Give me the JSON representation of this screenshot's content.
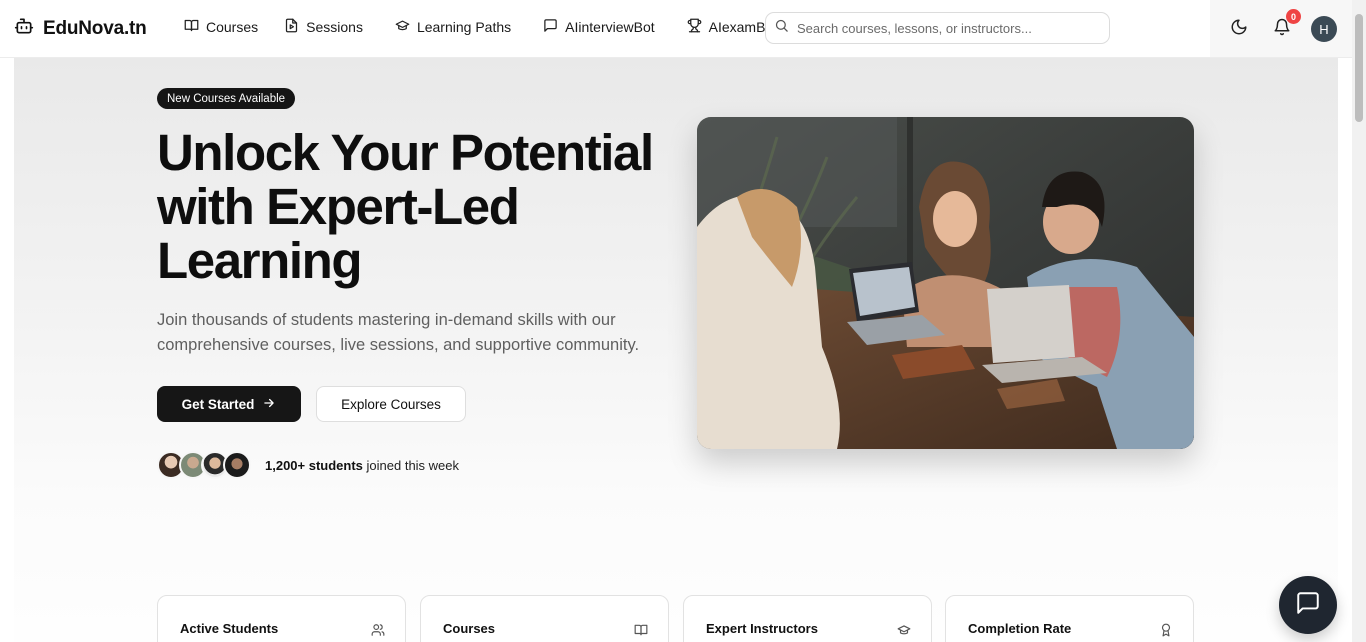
{
  "header": {
    "brand": "EduNova.tn",
    "nav": [
      {
        "label": "Courses",
        "icon": "book-open-icon"
      },
      {
        "label": "Sessions",
        "icon": "file-play-icon"
      },
      {
        "label": "Learning Paths",
        "icon": "graduation-cap-icon"
      },
      {
        "label": "AIinterviewBot",
        "icon": "message-square-icon"
      },
      {
        "label": "AIexamBot",
        "icon": "trophy-icon"
      }
    ],
    "search_placeholder": "Search courses, lessons, or instructors...",
    "notification_count": "0",
    "user_initial": "H"
  },
  "hero": {
    "badge": "New Courses Available",
    "title": "Unlock Your Potential with Expert-Led Learning",
    "subtitle": "Join thousands of students mastering in-demand skills with our comprehensive courses, live sessions, and supportive community.",
    "primary_button": "Get Started",
    "secondary_button": "Explore Courses",
    "joined_count": "1,200+ students",
    "joined_suffix": " joined this week"
  },
  "stats": [
    {
      "label": "Active Students",
      "icon": "users-icon"
    },
    {
      "label": "Courses",
      "icon": "book-open-icon"
    },
    {
      "label": "Expert Instructors",
      "icon": "graduation-cap-icon"
    },
    {
      "label": "Completion Rate",
      "icon": "award-icon"
    }
  ],
  "colors": {
    "primary": "#161616",
    "badge_red": "#ef4444",
    "chat_fab": "#1f2630"
  }
}
